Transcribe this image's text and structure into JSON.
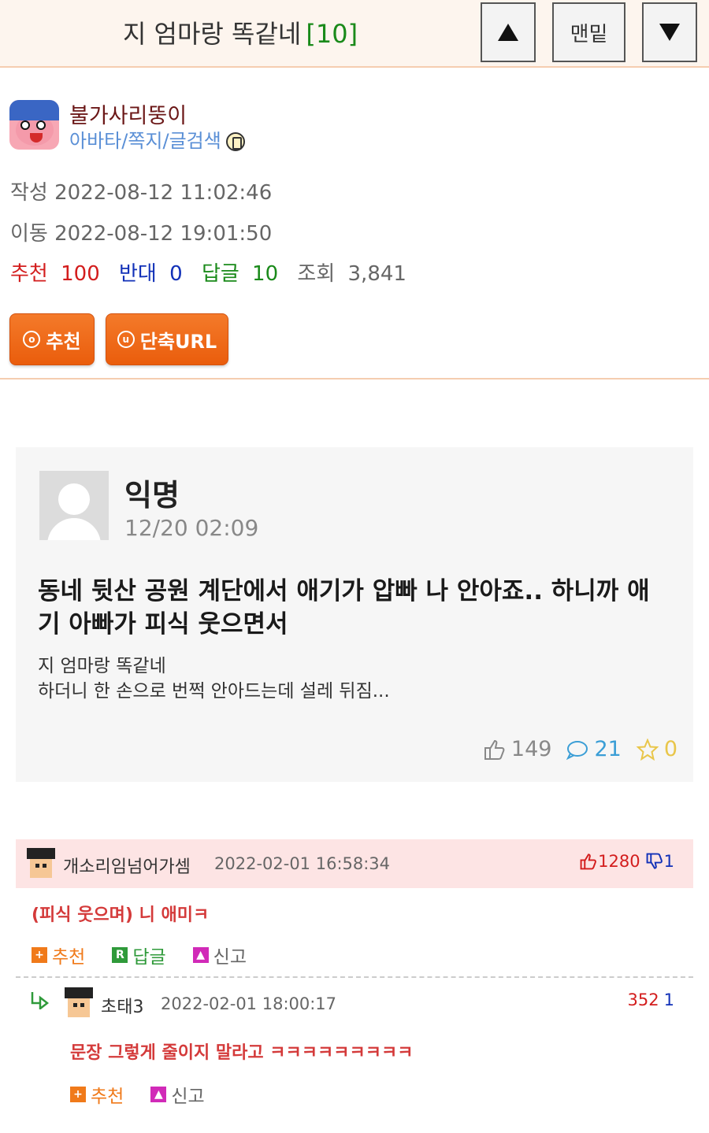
{
  "header": {
    "title": "지 엄마랑 똑같네",
    "reply_count": "[10]",
    "nav_up_icon": "triangle-up-icon",
    "nav_bottom_label": "맨밑",
    "nav_down_icon": "triangle-down-icon"
  },
  "author": {
    "name": "불가사리뚱이",
    "links": "아바타/쪽지/글검색"
  },
  "meta": {
    "created": "작성 2022-08-12 11:02:46",
    "moved": "이동 2022-08-12 19:01:50",
    "recommend_label": "추천",
    "recommend_value": "100",
    "oppose_label": "반대",
    "oppose_value": "0",
    "reply_label": "답글",
    "reply_value": "10",
    "view_label": "조회",
    "view_value": "3,841"
  },
  "buttons": {
    "recommend": "추천",
    "short_url": "단축URL",
    "recommend_icon_char": "o",
    "url_icon_char": "u"
  },
  "post_card": {
    "author": "익명",
    "time": "12/20 02:09",
    "headline": "동네 뒷산 공원 계단에서 애기가 압빠 나 안아죠.. 하니까 애기 아빠가 피식 웃으면서",
    "snippet_line1": "지 엄마랑 똑같네",
    "snippet_line2": "하더니 한 손으로 번쩍 안아드는데 설레 뒤짐...",
    "likes": "149",
    "comments": "21",
    "stars": "0"
  },
  "comments": [
    {
      "name": "개소리임넘어가셈",
      "date": "2022-02-01 16:58:34",
      "up": "1280",
      "down": "1",
      "text": "(피식 웃으며) 니 애미ㅋ",
      "actions": [
        "추천",
        "답글",
        "신고"
      ]
    },
    {
      "name": "초태3",
      "date": "2022-02-01 18:00:17",
      "up": "352",
      "down": "1",
      "text": "문장 그렇게 줄이지 말라고 ㅋㅋㅋㅋㅋㅋㅋㅋㅋ",
      "actions": [
        "추천",
        "신고"
      ]
    }
  ],
  "colors": {
    "accent_orange": "#ea5d0c",
    "recommend_red": "#d31d1d",
    "oppose_blue": "#1231b8",
    "reply_green": "#1a8a1a"
  }
}
